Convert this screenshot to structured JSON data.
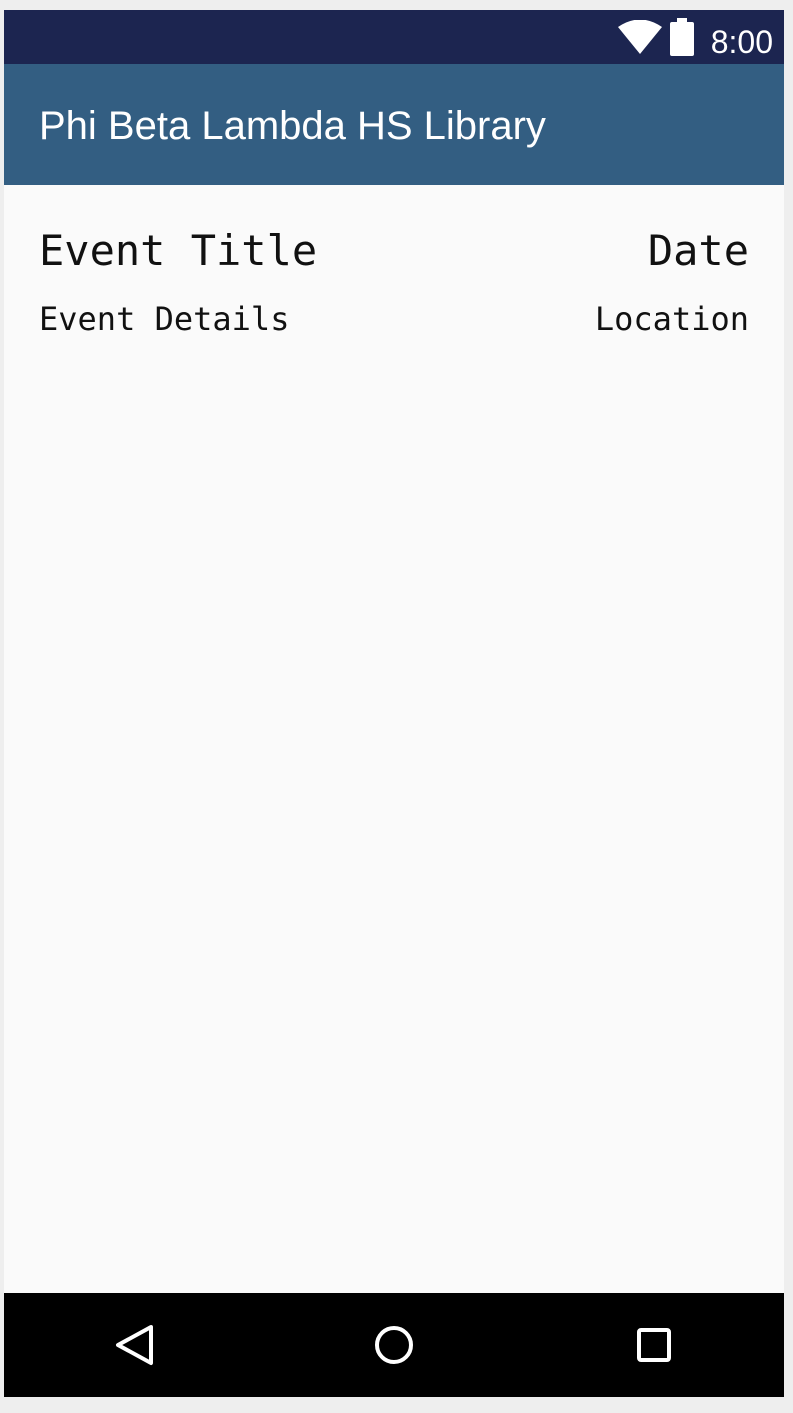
{
  "status_bar": {
    "time": "8:00",
    "icons": [
      "wifi-icon",
      "battery-icon"
    ],
    "background": "#1c2550"
  },
  "app_bar": {
    "title": "Phi Beta Lambda HS Library",
    "background": "#335e82"
  },
  "event": {
    "title": "Event Title",
    "date": "Date",
    "details": "Event Details",
    "location": "Location"
  },
  "nav_bar": {
    "buttons": [
      "back-icon",
      "home-icon",
      "recents-icon"
    ],
    "background": "#000000"
  }
}
